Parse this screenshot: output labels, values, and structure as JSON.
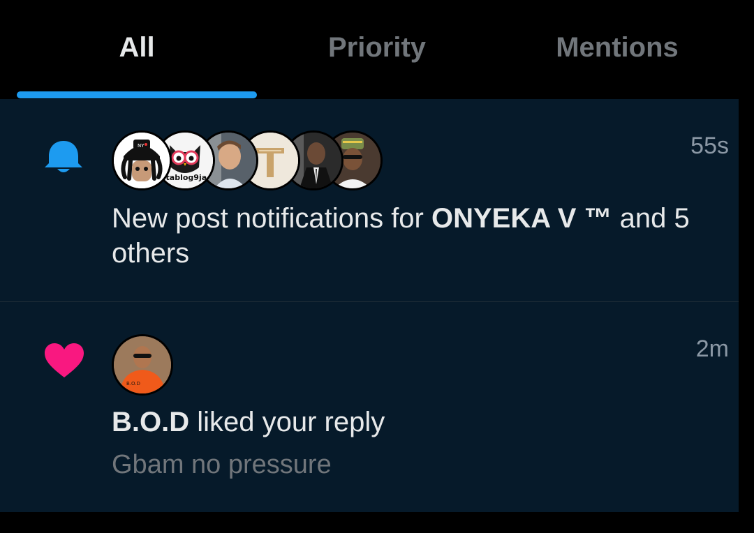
{
  "tabs": [
    {
      "label": "All",
      "active": true
    },
    {
      "label": "Priority",
      "active": false
    },
    {
      "label": "Mentions",
      "active": false
    }
  ],
  "colors": {
    "accent": "#1d9bf0",
    "like": "#f91880",
    "panel_bg": "#061a2a"
  },
  "notifications": [
    {
      "icon": "bell-icon",
      "timestamp": "55s",
      "avatar_count": 6,
      "avatar_text": "stablog9ja",
      "text_prefix": "New post notifications for ",
      "bold_name": "ONYEKA V ™",
      "text_suffix": " and 5 others"
    },
    {
      "icon": "heart-icon",
      "timestamp": "2m",
      "bold_name": "B.O.D",
      "text_suffix": " liked your reply",
      "subtext": "Gbam no pressure",
      "avatar_text": "B.O.D"
    }
  ]
}
